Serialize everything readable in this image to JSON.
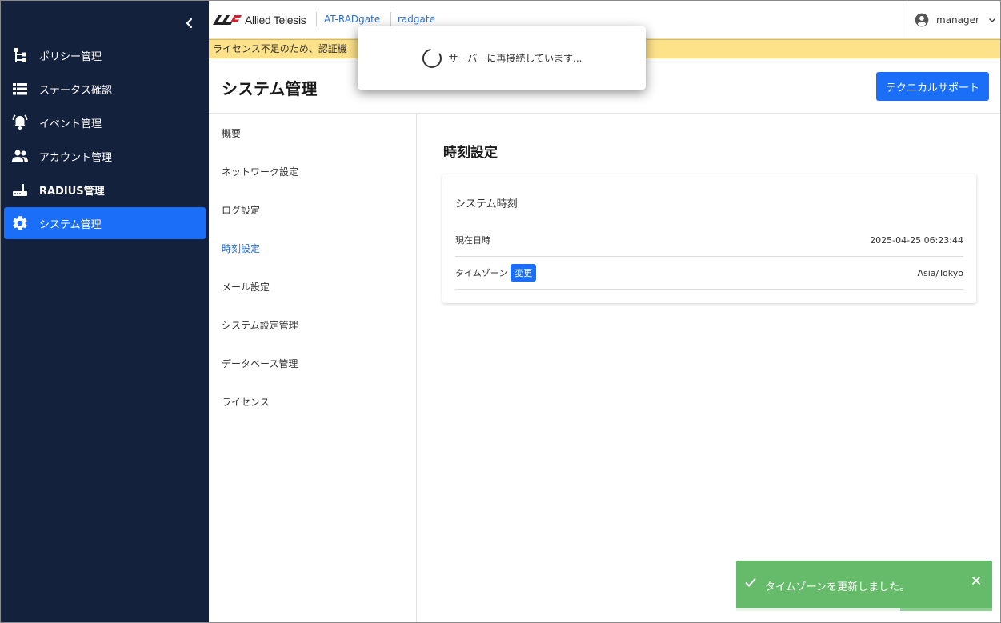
{
  "sidebar": {
    "collapse_icon": "chevron-left-icon",
    "items": [
      {
        "label": "ポリシー管理",
        "icon": "policy-tree-icon",
        "active": false
      },
      {
        "label": "ステータス確認",
        "icon": "list-icon",
        "active": false
      },
      {
        "label": "イベント管理",
        "icon": "alarm-bell-icon",
        "active": false
      },
      {
        "label": "アカウント管理",
        "icon": "people-icon",
        "active": false
      },
      {
        "label": "RADIUS管理",
        "icon": "router-icon",
        "active": false
      },
      {
        "label": "システム管理",
        "icon": "gear-icon",
        "active": true
      }
    ]
  },
  "topbar": {
    "brand": "Allied Telesis",
    "product": "AT-RADgate",
    "hostname": "radgate",
    "user": "manager"
  },
  "banner": {
    "text": "ライセンス不足のため、認証機"
  },
  "page": {
    "title": "システム管理",
    "tech_support_label": "テクニカルサポート"
  },
  "subnav": {
    "items": [
      {
        "label": "概要",
        "active": false
      },
      {
        "label": "ネットワーク設定",
        "active": false
      },
      {
        "label": "ログ設定",
        "active": false
      },
      {
        "label": "時刻設定",
        "active": true
      },
      {
        "label": "メール設定",
        "active": false
      },
      {
        "label": "システム設定管理",
        "active": false
      },
      {
        "label": "データベース管理",
        "active": false
      },
      {
        "label": "ライセンス",
        "active": false
      }
    ]
  },
  "content": {
    "section_title": "時刻設定",
    "card_title": "システム時刻",
    "rows": [
      {
        "label": "現在日時",
        "value": "2025-04-25 06:23:44"
      },
      {
        "label": "タイムゾーン",
        "value": "Asia/Tokyo",
        "action": "変更"
      }
    ]
  },
  "dialog": {
    "text": "サーバーに再接続しています..."
  },
  "toast": {
    "text": "タイムゾーンを更新しました。",
    "progress": 0.64
  },
  "colors": {
    "sidebar_bg": "#14213d",
    "accent": "#1a6ef7",
    "link": "#2a6fd6",
    "banner_bg": "#fde28a",
    "toast_bg": "#66bb6a"
  }
}
